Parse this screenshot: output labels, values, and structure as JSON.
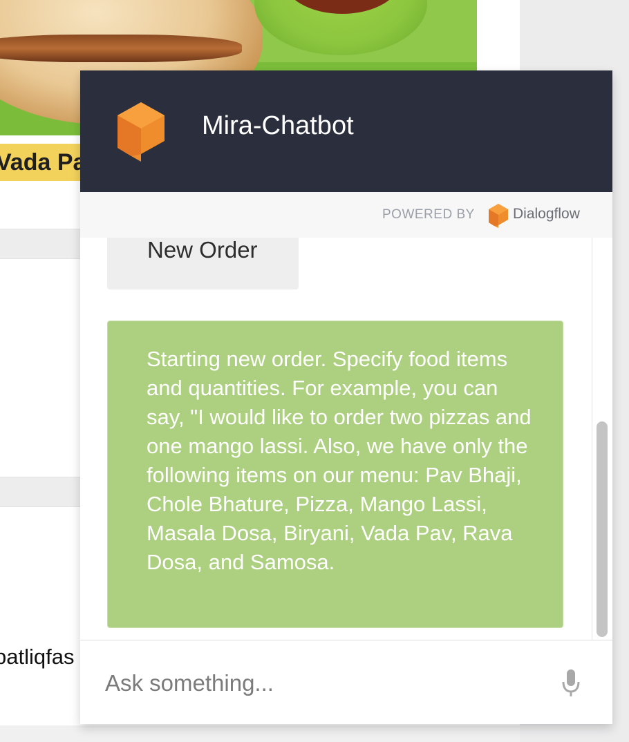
{
  "background_page": {
    "item_label": "Vada Pav",
    "partial_text": "patliqfas"
  },
  "chat": {
    "bot_name": "Mira-Chatbot",
    "powered_by_label": "POWERED BY",
    "provider_name": "Dialogflow",
    "messages": [
      {
        "role": "user",
        "text": "New Order"
      },
      {
        "role": "bot",
        "text": "Starting new order. Specify food items and quantities. For example, you can say, \"I would like to order two pizzas and one mango lassi. Also, we have only the following items on our menu: Pav Bhaji, Chole Bhature, Pizza, Mango Lassi, Masala Dosa, Biryani, Vada Pav, Rava Dosa, and Samosa."
      }
    ],
    "input": {
      "placeholder": "Ask something...",
      "value": ""
    },
    "icons": {
      "bot_logo": "dialogflow-bot-icon",
      "provider_logo": "dialogflow-logo-icon",
      "mic": "microphone-icon"
    }
  },
  "colors": {
    "header_bg": "#2b2f3d",
    "bot_bubble": "#acd07f",
    "user_bubble": "#eeeeee",
    "logo_orange": "#ef8c2c"
  }
}
